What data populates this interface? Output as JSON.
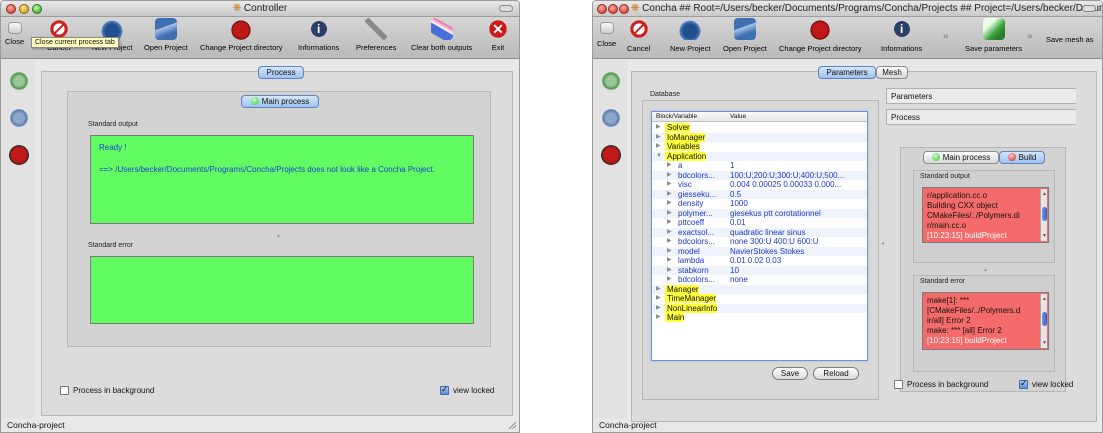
{
  "left_window": {
    "title": "Controller",
    "toolbar": {
      "close_label": "Close",
      "cancel_label": "Cancel",
      "new_project_label": "New Project",
      "open_project_label": "Open Project",
      "change_dir_label": "Change Project directory",
      "informations_label": "Informations",
      "preferences_label": "Preferences",
      "clear_outputs_label": "Clear both outputs",
      "exit_label": "Exit"
    },
    "tooltip": "Close current process tab",
    "process_tab": "Process",
    "main_process_label": "Main process",
    "standard_output_label": "Standard output",
    "standard_output_lines": [
      "Ready !",
      "",
      "==> /Users/becker/Documents/Programs/Concha/Projects does not look like a Concha Project."
    ],
    "standard_error_label": "Standard error",
    "process_background_label": "Process in background",
    "view_locked_label": "view locked",
    "status": "Concha-project"
  },
  "right_window": {
    "title": "Concha ## Root=/Users/becker/Documents/Programs/Concha/Projects ## Project=/Users/becker/Docum...",
    "toolbar": {
      "close_label": "Close",
      "cancel_label": "Cancel",
      "new_project_label": "New Project",
      "open_project_label": "Open Project",
      "change_dir_label": "Change Project directory",
      "informations_label": "Informations",
      "save_parameters_label": "Save parameters",
      "save_mesh_label": "Save mesh as",
      "overflow_1": "»",
      "overflow_2": "»"
    },
    "tabs": [
      "Parameters",
      "Mesh"
    ],
    "database_label": "Database",
    "tree_headers": [
      "Block/Variable",
      "Value"
    ],
    "tree_rows": [
      {
        "name": "Solver",
        "value": "",
        "style": "block",
        "indent": 0
      },
      {
        "name": "IoManager",
        "value": "",
        "style": "block",
        "indent": 0
      },
      {
        "name": "Variables",
        "value": "",
        "style": "block",
        "indent": 0
      },
      {
        "name": "Application",
        "value": "",
        "style": "block",
        "indent": 0,
        "expanded": true
      },
      {
        "name": "a",
        "value": "1",
        "style": "var",
        "indent": 1
      },
      {
        "name": "bdcolors...",
        "value": "100:U;200:U;300:U;400:U;500...",
        "style": "var",
        "indent": 1
      },
      {
        "name": "visc",
        "value": "0.004 0.00025 0.00033 0.000...",
        "style": "var",
        "indent": 1
      },
      {
        "name": "giesseku...",
        "value": "0.5",
        "style": "var",
        "indent": 1
      },
      {
        "name": "density",
        "value": "1000",
        "style": "var",
        "indent": 1
      },
      {
        "name": "polymer...",
        "value": "giesekus ptt corotationnel",
        "style": "var",
        "indent": 1
      },
      {
        "name": "pttcoeff",
        "value": "0.01",
        "style": "var",
        "indent": 1
      },
      {
        "name": "exactsol...",
        "value": "quadratic linear sinus",
        "style": "var",
        "indent": 1
      },
      {
        "name": "bdcolors...",
        "value": "none 300:U 400:U 600:U",
        "style": "var",
        "indent": 1
      },
      {
        "name": "model",
        "value": "NavierStokes Stokes",
        "style": "var",
        "indent": 1
      },
      {
        "name": "lambda",
        "value": "0.01 0.02 0.03",
        "style": "var",
        "indent": 1
      },
      {
        "name": "stabkorn",
        "value": "10",
        "style": "var",
        "indent": 1
      },
      {
        "name": "bdcolors...",
        "value": "none",
        "style": "var",
        "indent": 1
      },
      {
        "name": "Manager",
        "value": "",
        "style": "block",
        "indent": 0
      },
      {
        "name": "TimeManager",
        "value": "",
        "style": "block",
        "indent": 0
      },
      {
        "name": "NonLinearInfo",
        "value": "",
        "style": "block",
        "indent": 0
      },
      {
        "name": "Main",
        "value": "",
        "style": "block",
        "indent": 0
      }
    ],
    "save_button": "Save",
    "reload_button": "Reload",
    "side_tabs": [
      "Parameters",
      "Process"
    ],
    "main_process_label": "Main process",
    "build_label": "Build",
    "standard_output_label": "Standard output",
    "standard_output_lines": [
      "r/application.cc.o",
      "Building CXX object",
      "CMakeFiles/../Polymers.di",
      "r/main.cc.o"
    ],
    "standard_output_timestamp": "[10:23:15] buildProject",
    "standard_error_label": "Standard error",
    "standard_error_lines": [
      "make[1]: ***",
      "[CMakeFiles/../Polymers.d",
      "ir/all] Error 2",
      "make: *** [all] Error 2"
    ],
    "standard_error_timestamp": "[10:23:15] buildProject",
    "process_background_label": "Process in background",
    "view_locked_label": "view locked",
    "status": "Concha-project"
  },
  "colors": {
    "output_green": "#62fc62",
    "error_red": "#f56b6b",
    "highlight_yellow": "#ffff3a",
    "value_blue": "#1d39c9"
  }
}
